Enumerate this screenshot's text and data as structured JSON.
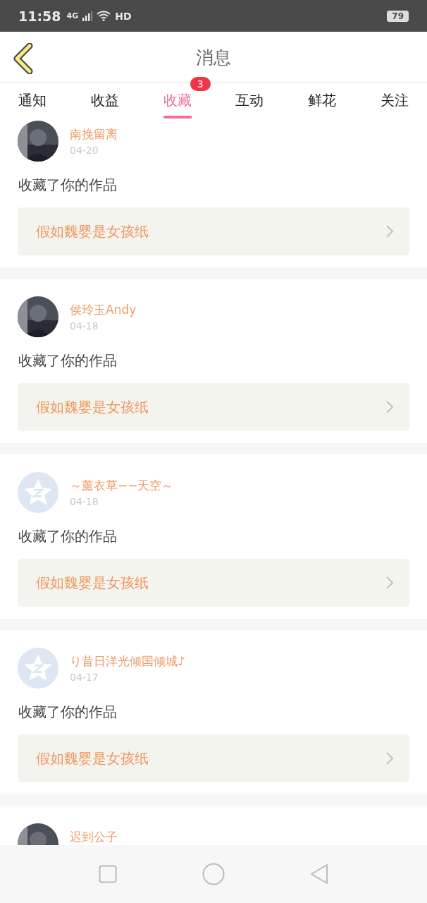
{
  "status_bar": {
    "time": "11:58",
    "network": "4G",
    "hd": "HD",
    "battery": "79"
  },
  "header": {
    "title": "消息"
  },
  "tabs": [
    {
      "label": "通知",
      "selected": false
    },
    {
      "label": "收益",
      "selected": false
    },
    {
      "label": "收藏",
      "selected": true,
      "badge": "3"
    },
    {
      "label": "互动",
      "selected": false
    },
    {
      "label": "鲜花",
      "selected": false
    },
    {
      "label": "关注",
      "selected": false
    }
  ],
  "messages": [
    {
      "name": "南挽留离",
      "date": "04-20",
      "text": "收藏了你的作品",
      "work": "假如魏婴是女孩纸"
    },
    {
      "name": "侯玲玉Andy",
      "date": "04-18",
      "text": "收藏了你的作品",
      "work": "假如魏婴是女孩纸"
    },
    {
      "avatar": {
        "kind": "default"
      },
      "name": "～薰衣草−−天空～",
      "date": "04-18",
      "text": "收藏了你的作品",
      "work": "假如魏婴是女孩纸"
    },
    {
      "avatar": {
        "kind": "default"
      },
      "name": "り昔日洋光倾国倾城♪",
      "date": "04-17",
      "text": "收藏了你的作品",
      "work": "假如魏婴是女孩纸"
    },
    {
      "name": "迟到公子"
    }
  ]
}
